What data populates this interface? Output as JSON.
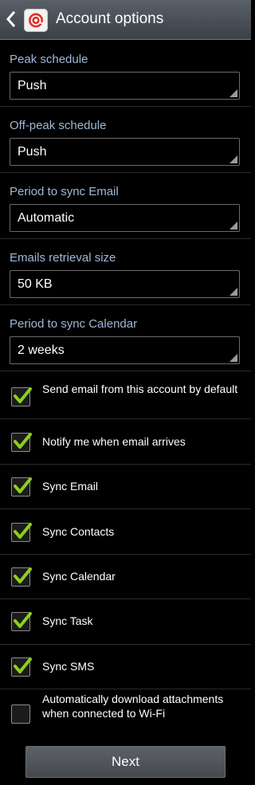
{
  "header": {
    "title": "Account options",
    "back_icon": "back-chevron-icon",
    "app_icon": "email-app-icon"
  },
  "settings": [
    {
      "label": "Peak schedule",
      "value": "Push"
    },
    {
      "label": "Off-peak schedule",
      "value": "Push"
    },
    {
      "label": "Period to sync Email",
      "value": "Automatic"
    },
    {
      "label": "Emails retrieval size",
      "value": "50 KB"
    },
    {
      "label": "Period to sync Calendar",
      "value": "2 weeks"
    }
  ],
  "options": [
    {
      "label": "Send email from this account by default",
      "checked": true
    },
    {
      "label": "Notify me when email arrives",
      "checked": true
    },
    {
      "label": "Sync Email",
      "checked": true
    },
    {
      "label": "Sync Contacts",
      "checked": true
    },
    {
      "label": "Sync Calendar",
      "checked": true
    },
    {
      "label": "Sync Task",
      "checked": true
    },
    {
      "label": "Sync SMS",
      "checked": true
    },
    {
      "label": "Automatically download attachments when connected to Wi-Fi",
      "checked": false
    }
  ],
  "footer": {
    "next_label": "Next"
  },
  "colors": {
    "section_label": "#9fb8d6",
    "check": "#8cd01c",
    "background": "#000000"
  }
}
